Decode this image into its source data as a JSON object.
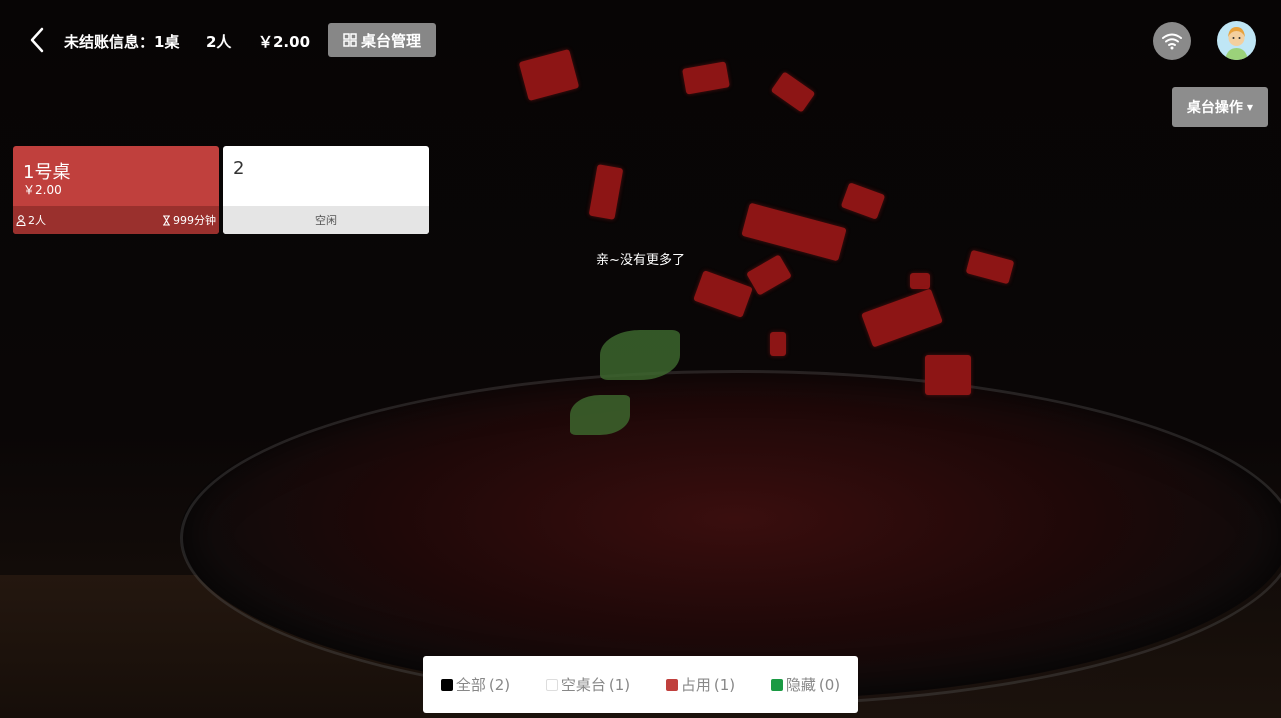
{
  "header": {
    "unsettled_label": "未结账信息：1桌",
    "people": "2人",
    "amount": "￥2.00",
    "table_mgmt_label": "桌台管理",
    "table_ops_label": "桌台操作"
  },
  "tables": [
    {
      "name": "1号桌",
      "price": "￥2.00",
      "people": "2人",
      "duration": "999分钟",
      "status": "占用"
    },
    {
      "name": "2",
      "status_label": "空闲"
    }
  ],
  "no_more_text": "亲~没有更多了",
  "legend": [
    {
      "label": "全部",
      "count": "(2)",
      "color": "#000000"
    },
    {
      "label": "空桌台",
      "count": "(1)",
      "color": "#ffffff"
    },
    {
      "label": "占用",
      "count": "(1)",
      "color": "#c0403d"
    },
    {
      "label": "隐藏",
      "count": "(0)",
      "color": "#1a9a43"
    }
  ],
  "colors": {
    "occupied": "#c0403d",
    "free": "#ffffff",
    "button_gray": "#878787"
  },
  "icons": [
    "back-icon",
    "grid-icon",
    "wifi-icon",
    "avatar",
    "person-icon",
    "hourglass-icon",
    "caret-down-icon"
  ]
}
